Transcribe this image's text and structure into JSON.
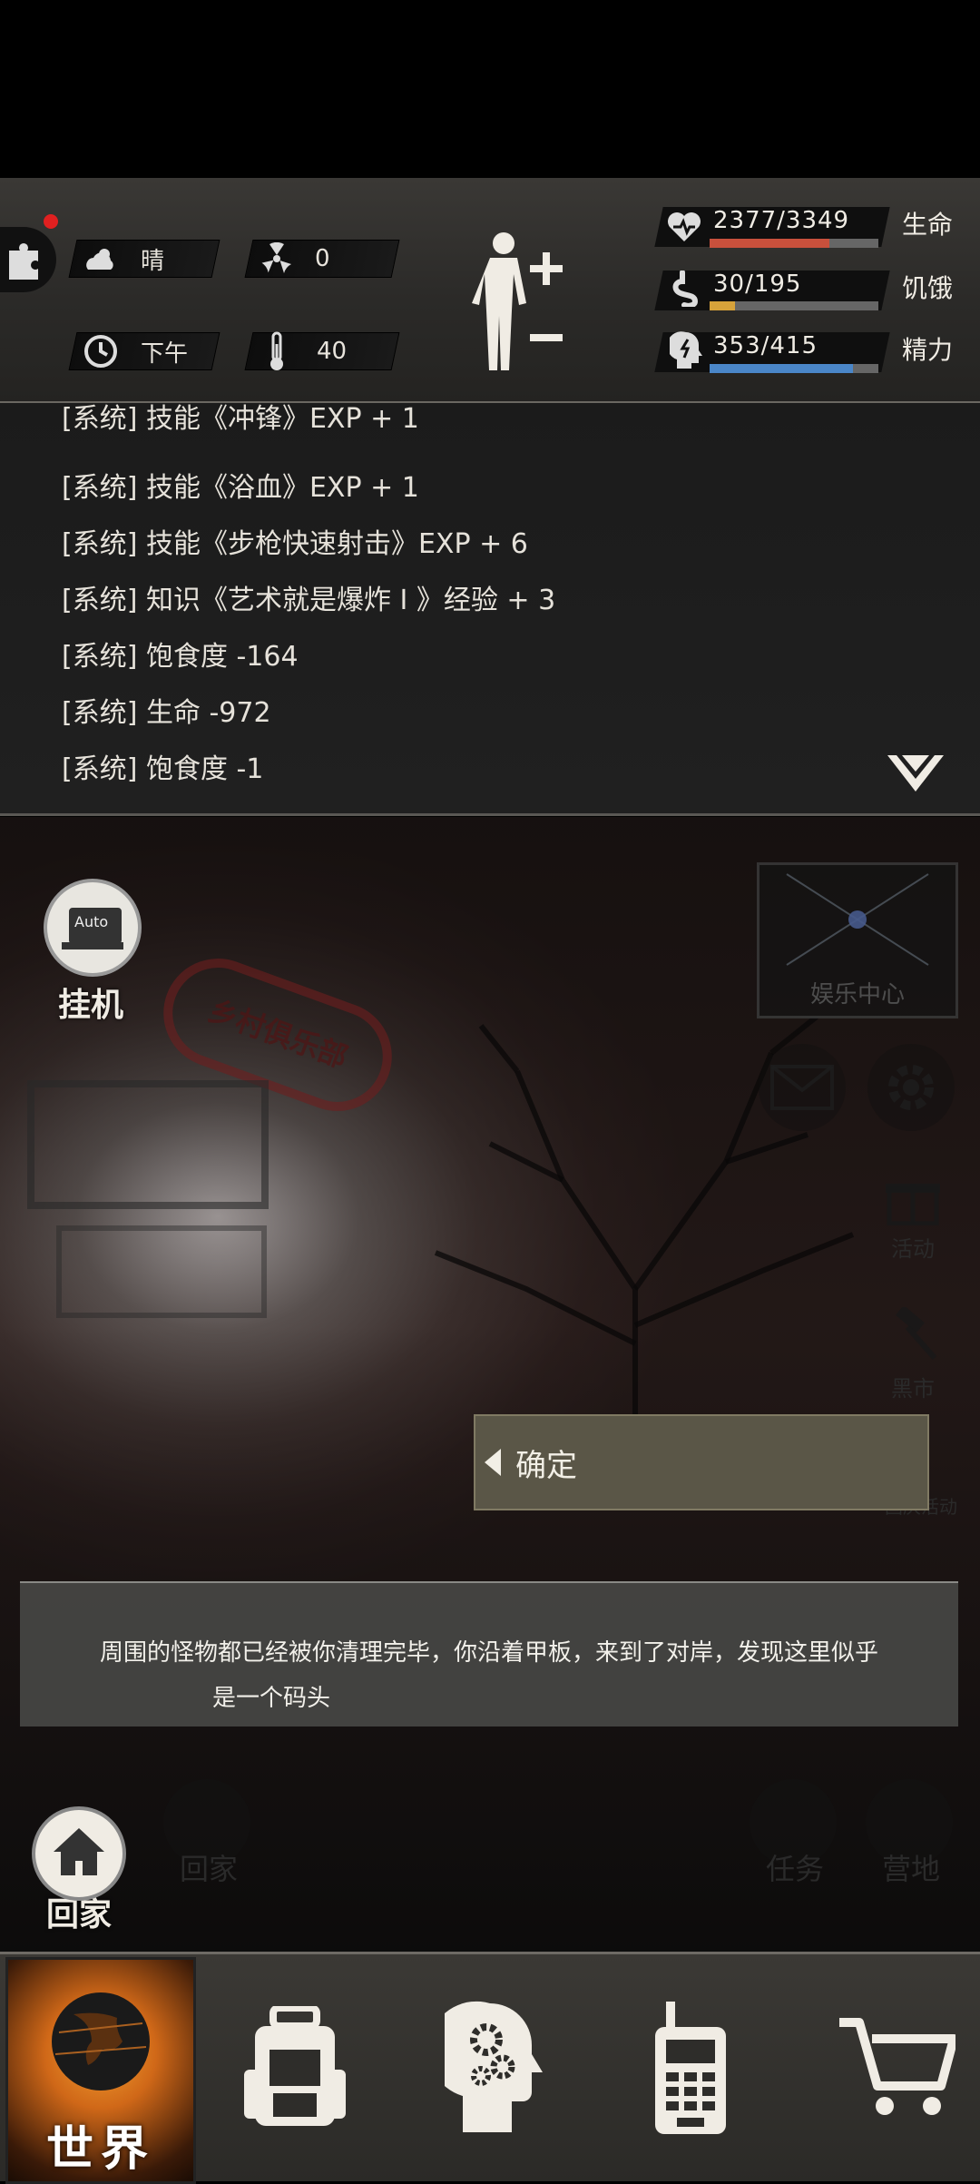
{
  "status": {
    "notification_dot_color": "#e02020",
    "weather": "晴",
    "radiation": "0",
    "time_of_day": "下午",
    "temperature": "40",
    "health": {
      "value": "2377/3349",
      "label": "生命",
      "fraction": 0.71,
      "color": "#c8503c"
    },
    "hunger": {
      "value": "30/195",
      "label": "饥饿",
      "fraction": 0.15,
      "color": "#d6a23a"
    },
    "energy": {
      "value": "353/415",
      "label": "精力",
      "fraction": 0.85,
      "color": "#4a86c8"
    }
  },
  "log": {
    "lines": [
      "[系统] 技能《冲锋》EXP + 1",
      "[系统] 技能《浴血》EXP + 1",
      "[系统] 技能《步枪快速射击》EXP + 6",
      "[系统] 知识《艺术就是爆炸 I 》经验 + 3",
      "[系统] 饱食度 -164",
      "[系统] 生命 -972",
      "[系统] 饱食度 -1"
    ]
  },
  "scene": {
    "auto_label": "Auto",
    "idle_label": "挂机",
    "entertainment_label": "娱乐中心",
    "event_label": "活动",
    "black_market_label": "黑市",
    "national_day_label": "国庆活动",
    "home_label": "回家",
    "task_label": "任务",
    "camp_label": "营地",
    "sign_text": "乡村俱乐部"
  },
  "dialog": {
    "confirm_label": "确定",
    "message_line1": "周围的怪物都已经被你清理完毕，你沿着甲板，来到了对岸，发现这里似乎",
    "message_line2": "是一个码头"
  },
  "nav": {
    "world_label": "世界"
  }
}
